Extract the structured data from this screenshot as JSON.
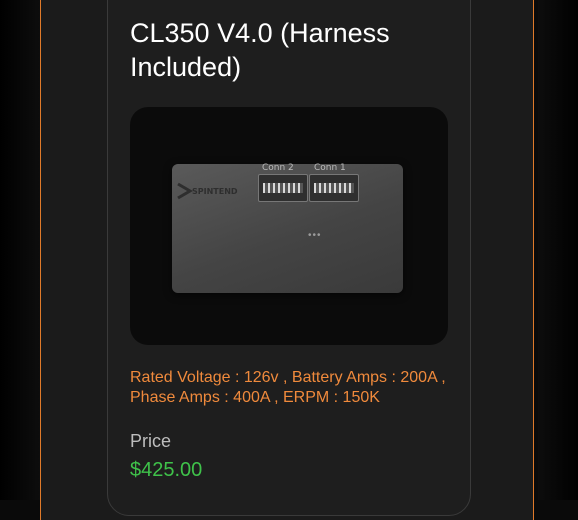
{
  "product": {
    "title": "CL350 V4.0 (Harness Included)",
    "specs": "Rated Voltage : 126v , Battery Amps : 200A , Phase Amps : 400A , ERPM : 150K",
    "price_label": "Price",
    "price": "$425.00",
    "image": {
      "connector_labels": [
        "Conn 2",
        "Conn 1"
      ],
      "logo_text": "SPINTEND",
      "dots": "•••"
    }
  },
  "colors": {
    "accent": "#e07a2a",
    "spec_text": "#f08a3c",
    "price": "#3fc24a",
    "card_bg": "#1e1e1e",
    "page_bg": "#0a0a0a"
  }
}
